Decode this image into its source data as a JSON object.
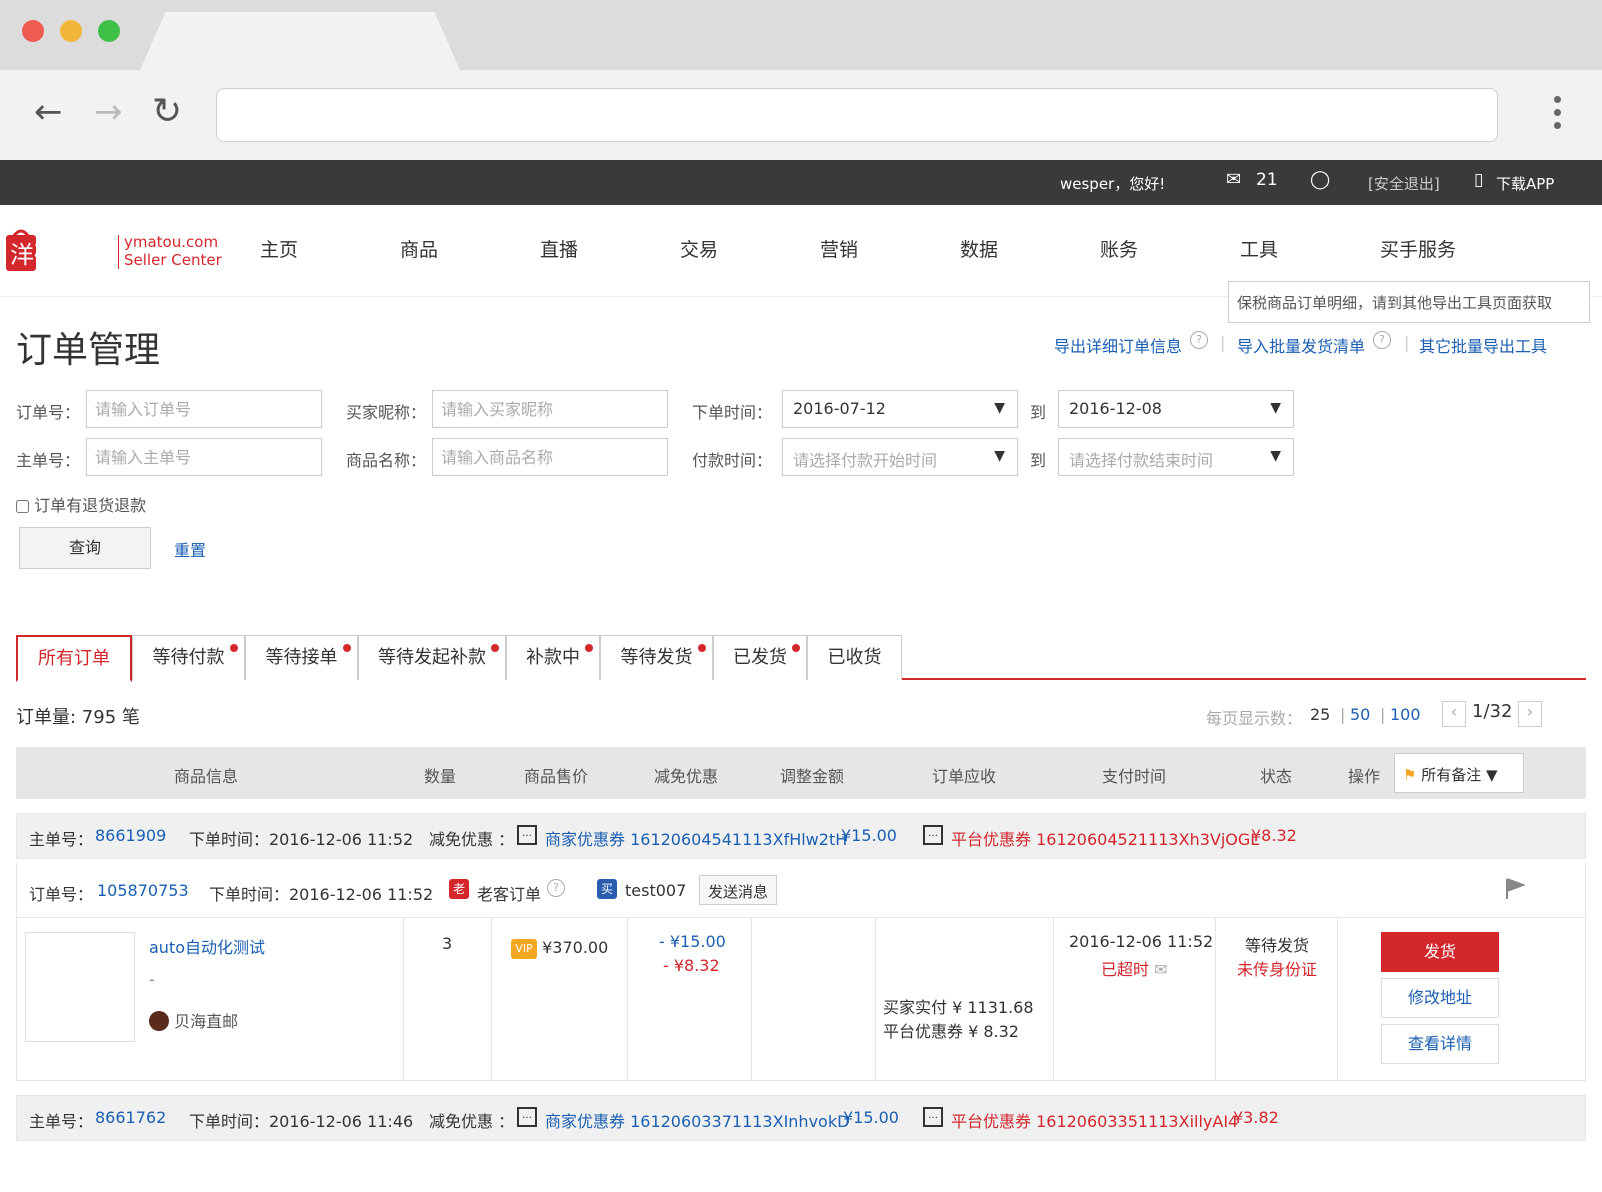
{
  "topbar": {
    "greeting": "wesper，您好!",
    "mail_count": "21",
    "logout": "[安全退出]",
    "download_app": "下载APP"
  },
  "brand": {
    "logo_cn": "洋码头",
    "site": "ymatou.com",
    "sub": "Seller Center"
  },
  "nav": [
    "主页",
    "商品",
    "直播",
    "交易",
    "营销",
    "数据",
    "账务",
    "工具",
    "买手服务"
  ],
  "page": {
    "title": "订单管理",
    "tooltip": "保税商品订单明细，请到其他导出工具页面获取",
    "export_links": [
      "导出详细订单信息",
      "导入批量发货清单",
      "其它批量导出工具"
    ]
  },
  "filters": {
    "order_no_label": "订单号：",
    "order_no_placeholder": "请输入订单号",
    "main_no_label": "主单号：",
    "main_no_placeholder": "请输入主单号",
    "buyer_label": "买家昵称：",
    "buyer_placeholder": "请输入买家昵称",
    "product_label": "商品名称：",
    "product_placeholder": "请输入商品名称",
    "order_time_label": "下单时间：",
    "order_time_from": "2016-07-12",
    "order_time_to": "2016-12-08",
    "to_label": "到",
    "pay_time_label": "付款时间：",
    "pay_time_from_placeholder": "请选择付款开始时间",
    "pay_time_to_placeholder": "请选择付款结束时间",
    "refund_checkbox": "订单有退货退款",
    "query_button": "查询",
    "reset_link": "重置"
  },
  "tabs": [
    {
      "label": "所有订单",
      "dot": false
    },
    {
      "label": "等待付款",
      "dot": true
    },
    {
      "label": "等待接单",
      "dot": true
    },
    {
      "label": "等待发起补款",
      "dot": true
    },
    {
      "label": "补款中",
      "dot": true
    },
    {
      "label": "等待发货",
      "dot": true
    },
    {
      "label": "已发货",
      "dot": true
    },
    {
      "label": "已收货",
      "dot": false
    }
  ],
  "summary": {
    "order_count": "订单量: 795 笔",
    "per_page_label": "每页显示数：",
    "per_page_options": [
      "25",
      "50",
      "100"
    ],
    "page_indicator": "1/32"
  },
  "table_headers": [
    "商品信息",
    "数量",
    "商品售价",
    "减免优惠",
    "调整金额",
    "订单应收",
    "支付时间",
    "状态",
    "操作"
  ],
  "remark_filter": "所有备注",
  "orders": [
    {
      "main_label": "主单号：",
      "main_no": "8661909",
      "main_time": "下单时间：2016-12-06 11:52",
      "discount_label": "减免优惠 ：",
      "merchant_coupon": "商家优惠券 16120604541113XfHlw2tH",
      "merchant_amount": "¥15.00",
      "platform_coupon": "平台优惠券 16120604521113Xh3VjOGL",
      "platform_amount": "¥8.32"
    },
    {
      "main_label": "主单号：",
      "main_no": "8661762",
      "main_time": "下单时间：2016-12-06 11:46",
      "discount_label": "减免优惠 ：",
      "merchant_coupon": "商家优惠券 16120603371113XInhvokD",
      "merchant_amount": "¥15.00",
      "platform_coupon": "平台优惠券 16120603351113XillyAI4",
      "platform_amount": "¥3.82"
    }
  ],
  "sub_order": {
    "label": "订单号：",
    "order_no": "105870753",
    "time": "下单时间：2016-12-06 11:52",
    "old_badge": "老",
    "old_customer": "老客订单",
    "buy_badge": "买",
    "buyer": "test007",
    "send_message": "发送消息",
    "product_name": "auto自动化测试",
    "product_spec": "-",
    "logistics": "贝海直邮",
    "qty": "3",
    "vip": "VIP",
    "price": "¥370.00",
    "discount1": "- ¥15.00",
    "discount2": "- ¥8.32",
    "buyer_paid": "买家实付 ¥ 1131.68",
    "platform_coupon_paid": "平台优惠券 ¥ 8.32",
    "pay_time": "2016-12-06 11:52",
    "overtime": "已超时",
    "status": "等待发货",
    "status_note": "未传身份证",
    "ship_button": "发货",
    "edit_address": "修改地址",
    "view_detail": "查看详情"
  },
  "colors": {
    "accent": "#d4272c",
    "link": "#1a5fb4",
    "topbar": "#3a3a3a"
  }
}
